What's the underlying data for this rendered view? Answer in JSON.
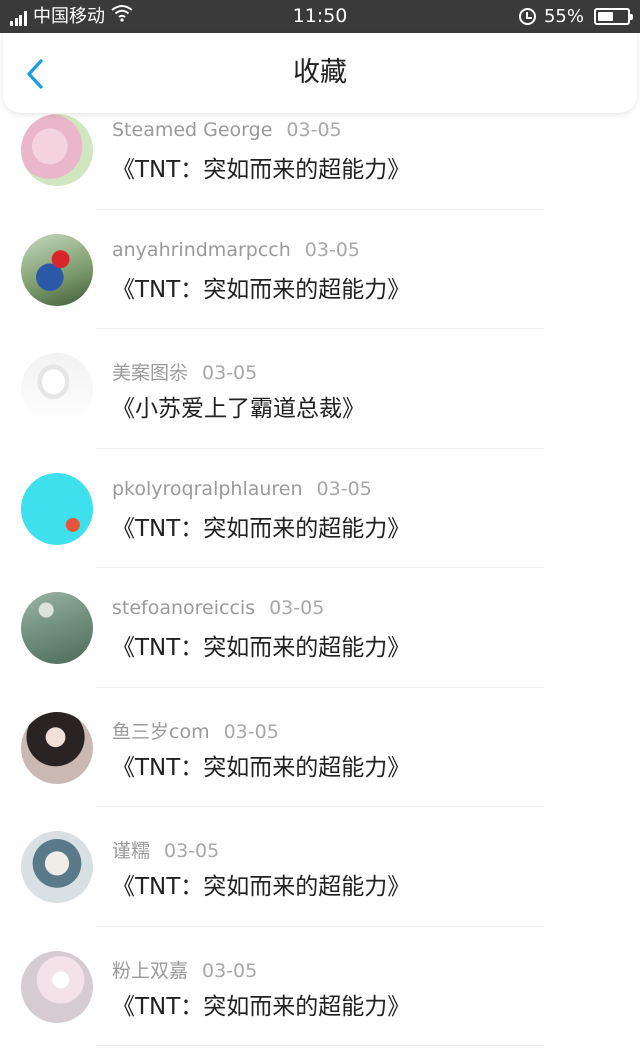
{
  "status_bar": {
    "network": "4G",
    "carrier": "中国移动",
    "time": "11:50",
    "battery_pct": "55%",
    "battery_level": 0.55
  },
  "header": {
    "title": "收藏",
    "back_icon": "chevron-left-icon",
    "accent": "#1a9be6"
  },
  "items": [
    {
      "user": "Steamed George",
      "date": "03-05",
      "book": "《TNT：突如而来的超能力》",
      "avatar": "pink-anime-avatar"
    },
    {
      "user": "anyahrindmarpcch",
      "date": "03-05",
      "book": "《TNT：突如而来的超能力》",
      "avatar": "christmas-child-avatar"
    },
    {
      "user": "美案图尜",
      "date": "03-05",
      "book": "《小苏爱上了霸道总裁》",
      "avatar": "pokemon-avatar"
    },
    {
      "user": "pkolyroqralphlauren",
      "date": "03-05",
      "book": "《TNT：突如而来的超能力》",
      "avatar": "cyan-text-avatar"
    },
    {
      "user": "stefoanoreiccis",
      "date": "03-05",
      "book": "《TNT：突如而来的超能力》",
      "avatar": "dandelion-avatar"
    },
    {
      "user": "鱼三岁com",
      "date": "03-05",
      "book": "《TNT：突如而来的超能力》",
      "avatar": "girl-ribbon-avatar"
    },
    {
      "user": "谨糯",
      "date": "03-05",
      "book": "《TNT：突如而来的超能力》",
      "avatar": "anime-boy-avatar"
    },
    {
      "user": "粉上双嘉",
      "date": "03-05",
      "book": "《TNT：突如而来的超能力》",
      "avatar": "pastel-avatar"
    }
  ]
}
